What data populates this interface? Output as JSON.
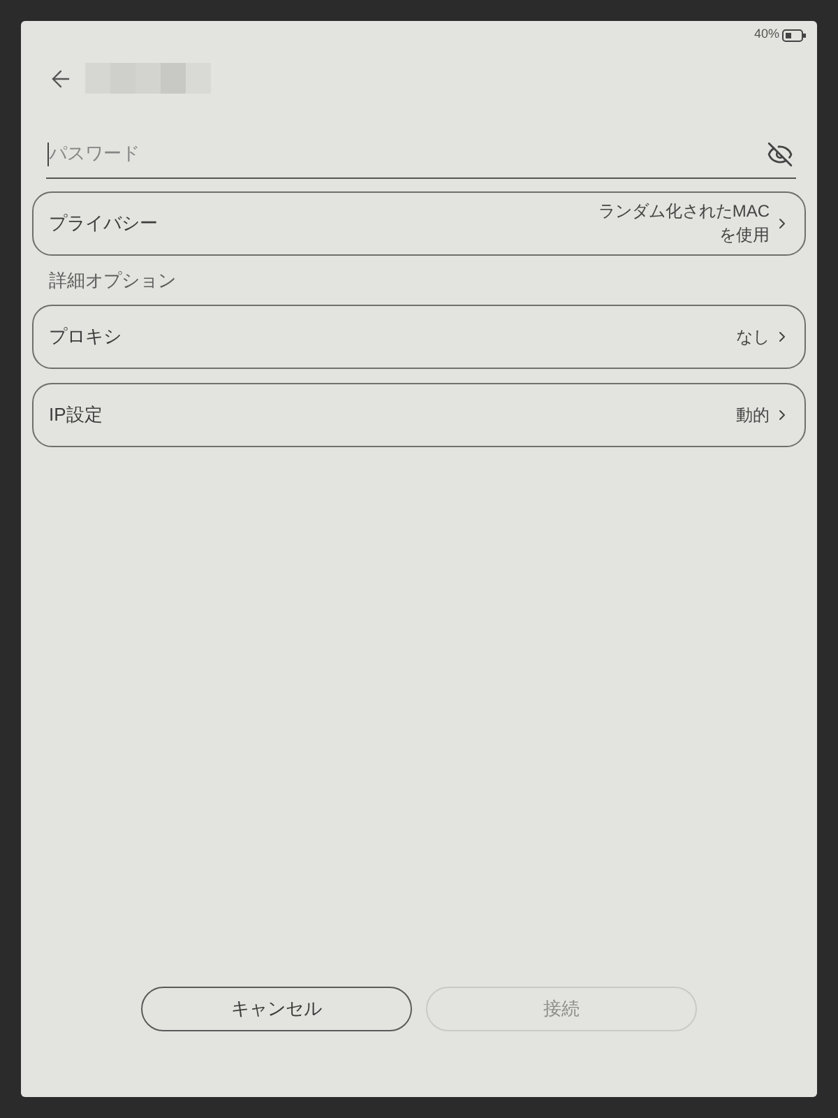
{
  "status_bar": {
    "battery": "40%"
  },
  "password_field": {
    "placeholder": "パスワード",
    "focused": true,
    "visible": false
  },
  "settings": [
    {
      "label": "プライバシー",
      "value": "ランダム化されたMACを使用"
    }
  ],
  "advanced_options": {
    "heading": "詳細オプション",
    "items": [
      {
        "label": "プロキシ",
        "value": "なし"
      },
      {
        "label": "IP設定",
        "value": "動的"
      }
    ]
  },
  "buttons": [
    {
      "label": "キャンセル",
      "disabled": false
    },
    {
      "label": "接続",
      "disabled": true
    }
  ]
}
